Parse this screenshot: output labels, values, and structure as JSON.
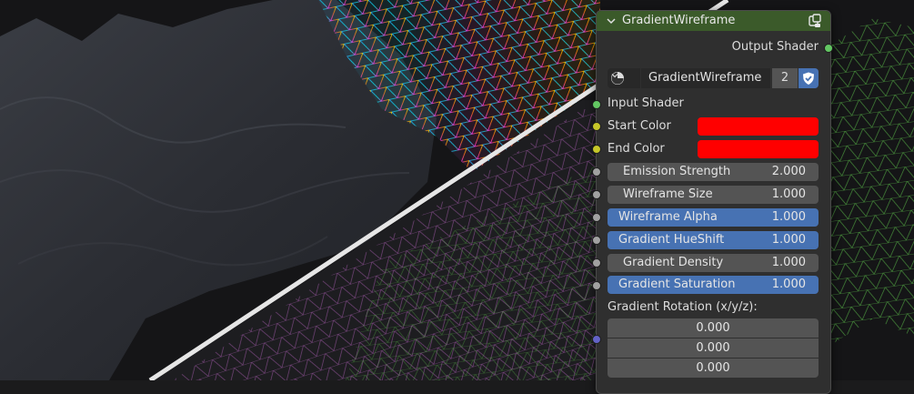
{
  "node": {
    "title": "GradientWireframe",
    "output_label": "Output Shader",
    "datablock": {
      "name": "GradientWireframe",
      "users": "2"
    },
    "input_shader_label": "Input Shader",
    "start_color_label": "Start Color",
    "end_color_label": "End Color",
    "colors": {
      "start": "#ff0000",
      "end": "#ff0000",
      "header": "#3b5a2a",
      "active_field": "#4772b3"
    },
    "fields": [
      {
        "label": "Emission Strength",
        "value": "2.000"
      },
      {
        "label": "Wireframe Size",
        "value": "1.000"
      },
      {
        "label": "Wireframe Alpha",
        "value": "1.000"
      },
      {
        "label": "Gradient HueShift",
        "value": "1.000"
      },
      {
        "label": "Gradient Density",
        "value": "1.000"
      },
      {
        "label": "Gradient Saturation",
        "value": "1.000"
      }
    ],
    "rotation_label": "Gradient Rotation (x/y/z):",
    "rotation": {
      "x": "0.000",
      "y": "0.000",
      "z": "0.000"
    }
  },
  "icons": [
    "chevron-down-icon",
    "node-preview-icon",
    "material-type-icon",
    "fake-user-shield-icon"
  ]
}
